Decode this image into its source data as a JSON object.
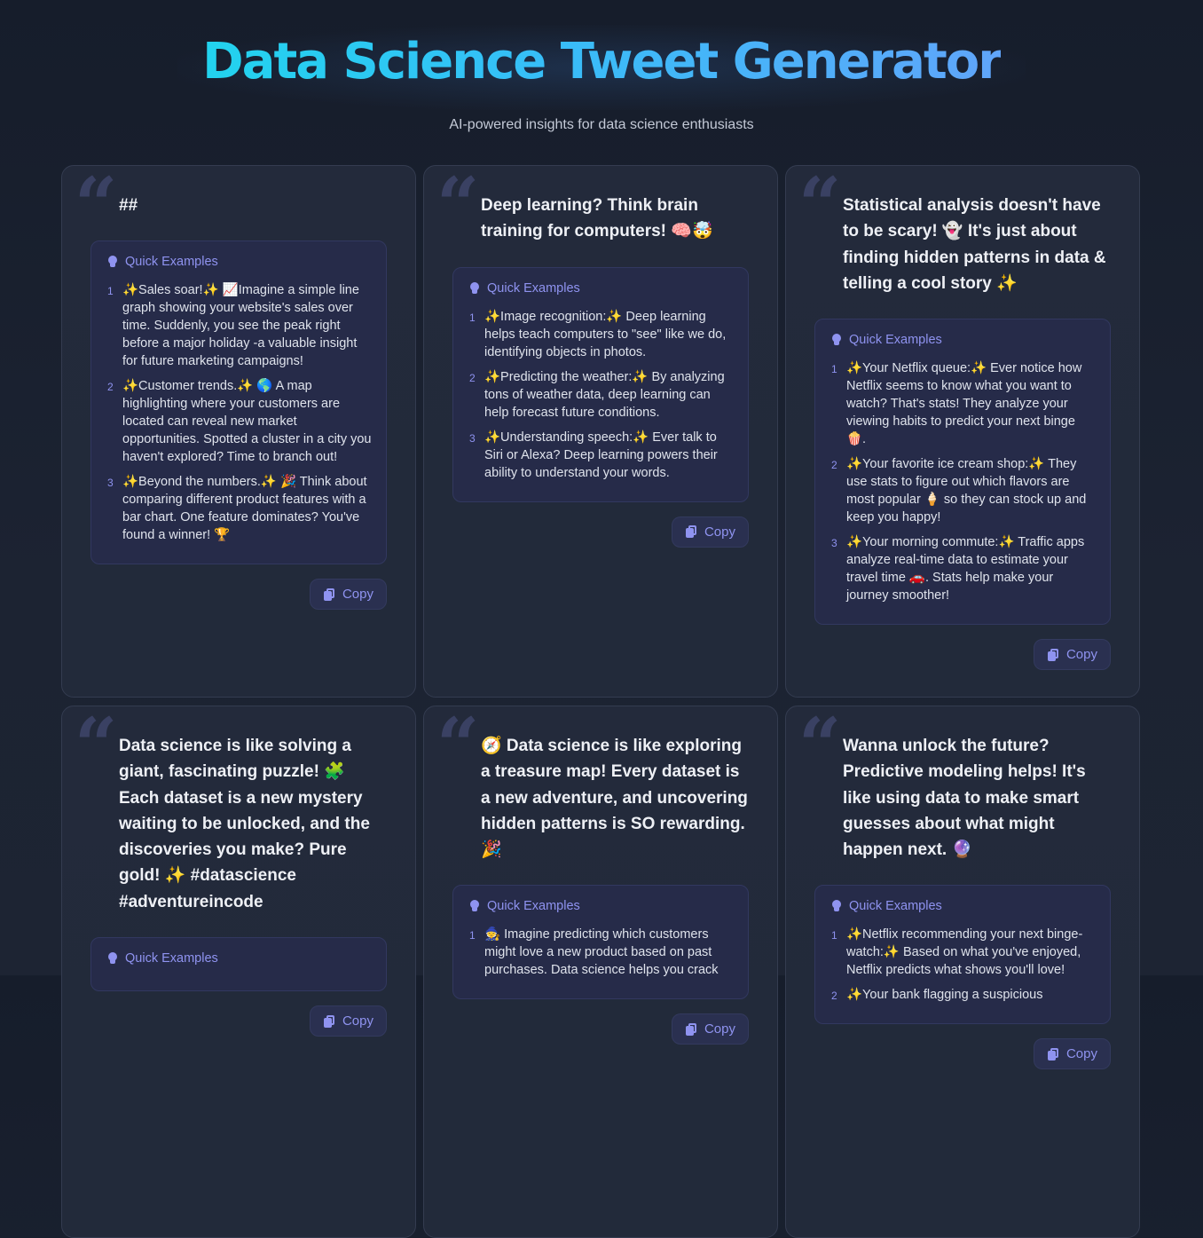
{
  "header": {
    "title": "Data Science Tweet Generator",
    "subtitle": "AI-powered insights for data science enthusiasts"
  },
  "examples_label": "Quick Examples",
  "copy_label": "Copy",
  "cards": [
    {
      "tweet": "##",
      "examples": [
        "✨Sales soar!✨ 📈Imagine a simple line graph showing your website's sales over time. Suddenly, you see the peak right before a major holiday -a valuable insight for future marketing campaigns!",
        "✨Customer trends.✨ 🌎 A map highlighting where your customers are located can reveal new market opportunities. Spotted a cluster in a city you haven't explored? Time to branch out!",
        "✨Beyond the numbers.✨ 🎉 Think about comparing different product features with a bar chart. One feature dominates? You've found a winner! 🏆"
      ]
    },
    {
      "tweet": "Deep learning? Think brain training for computers! 🧠🤯",
      "examples": [
        "✨Image recognition:✨ Deep learning helps teach computers to \"see\" like we do, identifying objects in photos.",
        "✨Predicting the weather:✨ By analyzing tons of weather data, deep learning can help forecast future conditions.",
        "✨Understanding speech:✨ Ever talk to Siri or Alexa? Deep learning powers their ability to understand your words."
      ]
    },
    {
      "tweet": "Statistical analysis doesn't have to be scary! 👻 It's just about finding hidden patterns in data & telling a cool story ✨",
      "examples": [
        "✨Your Netflix queue:✨ Ever notice how Netflix seems to know what you want to watch? That's stats! They analyze your viewing habits to predict your next binge 🍿.",
        "✨Your favorite ice cream shop:✨ They use stats to figure out which flavors are most popular 🍦 so they can stock up and keep you happy!",
        "✨Your morning commute:✨ Traffic apps analyze real-time data to estimate your travel time 🚗. Stats help make your journey smoother!"
      ]
    },
    {
      "tweet": "Data science is like solving a giant, fascinating puzzle! 🧩 Each dataset is a new mystery waiting to be unlocked, and the discoveries you make? Pure gold! ✨ #datascience #adventureincode",
      "examples": []
    },
    {
      "tweet": "🧭 Data science is like exploring a treasure map! Every dataset is a new adventure, and uncovering hidden patterns is SO rewarding. 🎉",
      "examples": [
        "🧙 Imagine predicting which customers might love a new product based on past purchases. Data science helps you crack"
      ]
    },
    {
      "tweet": "Wanna unlock the future? Predictive modeling helps! It's like using data to make smart guesses about what might happen next. 🔮",
      "examples": [
        "✨Netflix recommending your next binge-watch:✨ Based on what you've enjoyed, Netflix predicts what shows you'll love!",
        "✨Your bank flagging a suspicious"
      ]
    }
  ]
}
